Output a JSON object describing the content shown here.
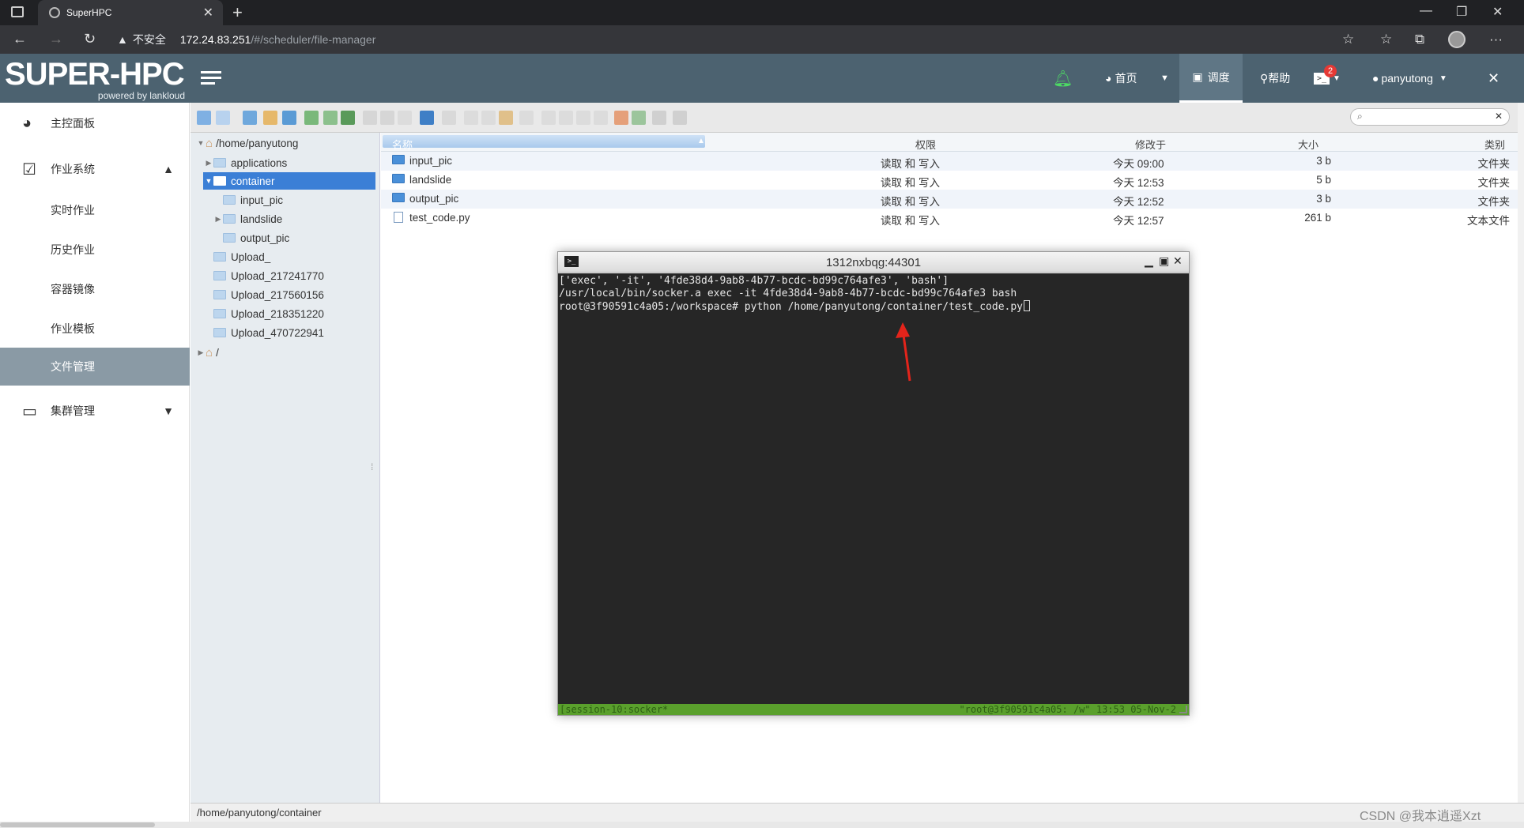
{
  "browser": {
    "tab_title": "SuperHPC",
    "security_label": "不安全",
    "url_host": "172.24.83.251",
    "url_path": "/#/scheduler/file-manager"
  },
  "header": {
    "logo_main": "SUPER-HPC",
    "logo_sub": "powered by lankloud",
    "home_label": "首页",
    "schedule_label": "调度",
    "help_label": "帮助",
    "terminal_badge": "2",
    "username": "panyutong",
    "accent": "#4c6270"
  },
  "sidebar": {
    "items": [
      {
        "label": "主控面板"
      },
      {
        "label": "作业系统"
      },
      {
        "label": "实时作业"
      },
      {
        "label": "历史作业"
      },
      {
        "label": "容器镜像"
      },
      {
        "label": "作业模板"
      },
      {
        "label": "文件管理"
      },
      {
        "label": "集群管理"
      }
    ]
  },
  "tree": {
    "root": "/home/panyutong",
    "items": [
      {
        "label": "applications"
      },
      {
        "label": "container"
      },
      {
        "label": "input_pic"
      },
      {
        "label": "landslide"
      },
      {
        "label": "output_pic"
      },
      {
        "label": "Upload_"
      },
      {
        "label": "Upload_217241770"
      },
      {
        "label": "Upload_217560156"
      },
      {
        "label": "Upload_218351220"
      },
      {
        "label": "Upload_470722941"
      },
      {
        "label": "/"
      }
    ]
  },
  "filelist": {
    "columns": [
      "名称",
      "权限",
      "修改于",
      "大小",
      "类别"
    ],
    "rows": [
      {
        "name": "input_pic",
        "perm": "读取 和 写入",
        "modified": "今天 09:00",
        "size": "3 b",
        "kind": "文件夹"
      },
      {
        "name": "landslide",
        "perm": "读取 和 写入",
        "modified": "今天 12:53",
        "size": "5 b",
        "kind": "文件夹"
      },
      {
        "name": "output_pic",
        "perm": "读取 和 写入",
        "modified": "今天 12:52",
        "size": "3 b",
        "kind": "文件夹"
      },
      {
        "name": "test_code.py",
        "perm": "读取 和 写入",
        "modified": "今天 12:57",
        "size": "261 b",
        "kind": "文本文件"
      }
    ]
  },
  "terminal": {
    "title": "1312nxbqg:44301",
    "lines": [
      "['exec', '-it', '4fde38d4-9ab8-4b77-bcdc-bd99c764afe3', 'bash']",
      "/usr/local/bin/socker.a exec -it 4fde38d4-9ab8-4b77-bcdc-bd99c764afe3 bash",
      "root@3f90591c4a05:/workspace# python /home/panyutong/container/test_code.py"
    ],
    "status_left": "[session-10:socker*",
    "status_right": "\"root@3f90591c4a05: /w\" 13:53 05-Nov-2"
  },
  "status": {
    "path": "/home/panyutong/container"
  },
  "watermark": "CSDN @我本逍遥Xzt"
}
